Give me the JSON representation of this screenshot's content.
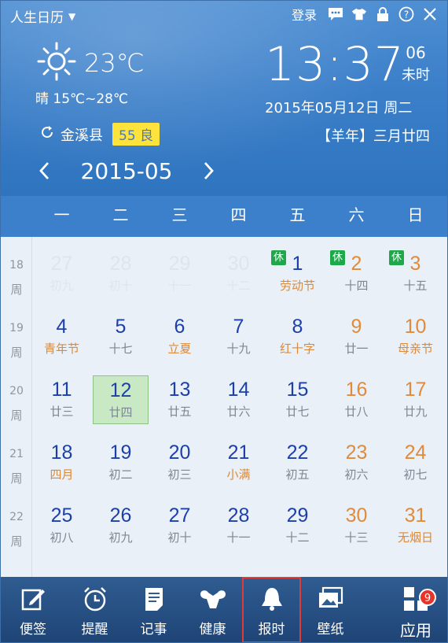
{
  "app": {
    "title": "人生日历"
  },
  "top_actions": {
    "login": "登录"
  },
  "weather": {
    "temp_now": "23℃",
    "desc_range": "晴 15℃~28℃"
  },
  "clock": {
    "time": "13:37",
    "seconds": "06",
    "seconds_label": "未时",
    "date_line": "2015年05月12日 周二"
  },
  "location": {
    "city": "金溪县",
    "aqi": "55 良",
    "lunar": "【羊年】三月廿四"
  },
  "month_nav": {
    "label": "2015-05"
  },
  "weekdays": [
    "一",
    "二",
    "三",
    "四",
    "五",
    "六",
    "日"
  ],
  "weeks": [
    {
      "num": "18",
      "label": "周"
    },
    {
      "num": "19",
      "label": "周"
    },
    {
      "num": "20",
      "label": "周"
    },
    {
      "num": "21",
      "label": "周"
    },
    {
      "num": "22",
      "label": "周"
    }
  ],
  "holiday_tag": "休",
  "days": [
    {
      "day": "27",
      "sub": "初九",
      "style": "muted"
    },
    {
      "day": "28",
      "sub": "初十",
      "style": "muted"
    },
    {
      "day": "29",
      "sub": "十一",
      "style": "muted"
    },
    {
      "day": "30",
      "sub": "十二",
      "style": "muted"
    },
    {
      "day": "1",
      "sub": "劳动节",
      "style": "holiday-weekday",
      "rest": true
    },
    {
      "day": "2",
      "sub": "十四",
      "style": "weekend",
      "rest": true
    },
    {
      "day": "3",
      "sub": "十五",
      "style": "weekend",
      "rest": true
    },
    {
      "day": "4",
      "sub": "青年节",
      "style": "festival"
    },
    {
      "day": "5",
      "sub": "十七",
      "style": "normal"
    },
    {
      "day": "6",
      "sub": "立夏",
      "style": "festival"
    },
    {
      "day": "7",
      "sub": "十九",
      "style": "normal"
    },
    {
      "day": "8",
      "sub": "红十字",
      "style": "festival"
    },
    {
      "day": "9",
      "sub": "廿一",
      "style": "weekend"
    },
    {
      "day": "10",
      "sub": "母亲节",
      "style": "weekend-festival"
    },
    {
      "day": "11",
      "sub": "廿三",
      "style": "normal"
    },
    {
      "day": "12",
      "sub": "廿四",
      "style": "normal",
      "selected": true
    },
    {
      "day": "13",
      "sub": "廿五",
      "style": "normal"
    },
    {
      "day": "14",
      "sub": "廿六",
      "style": "normal"
    },
    {
      "day": "15",
      "sub": "廿七",
      "style": "normal"
    },
    {
      "day": "16",
      "sub": "廿八",
      "style": "weekend"
    },
    {
      "day": "17",
      "sub": "廿九",
      "style": "weekend"
    },
    {
      "day": "18",
      "sub": "四月",
      "style": "festival"
    },
    {
      "day": "19",
      "sub": "初二",
      "style": "normal"
    },
    {
      "day": "20",
      "sub": "初三",
      "style": "normal"
    },
    {
      "day": "21",
      "sub": "小满",
      "style": "festival"
    },
    {
      "day": "22",
      "sub": "初五",
      "style": "normal"
    },
    {
      "day": "23",
      "sub": "初六",
      "style": "weekend"
    },
    {
      "day": "24",
      "sub": "初七",
      "style": "weekend"
    },
    {
      "day": "25",
      "sub": "初八",
      "style": "normal"
    },
    {
      "day": "26",
      "sub": "初九",
      "style": "normal"
    },
    {
      "day": "27",
      "sub": "初十",
      "style": "normal"
    },
    {
      "day": "28",
      "sub": "十一",
      "style": "normal"
    },
    {
      "day": "29",
      "sub": "十二",
      "style": "normal"
    },
    {
      "day": "30",
      "sub": "十三",
      "style": "weekend"
    },
    {
      "day": "31",
      "sub": "无烟日",
      "style": "weekend-festival"
    }
  ],
  "toolbar": [
    {
      "label": "便签",
      "icon": "note-icon"
    },
    {
      "label": "提醒",
      "icon": "alarm-icon"
    },
    {
      "label": "记事",
      "icon": "journal-icon"
    },
    {
      "label": "健康",
      "icon": "health-icon"
    },
    {
      "label": "报时",
      "icon": "bell-icon"
    },
    {
      "label": "壁纸",
      "icon": "wallpaper-icon"
    },
    {
      "label": "应用",
      "icon": "apps-icon",
      "badge": "9"
    }
  ],
  "colors": {
    "header": "#3b7fc9",
    "weekbar": "#3c7fca",
    "toolbar": "#2f5c91",
    "blue_day": "#1d3fa8",
    "orange_day": "#e08a3b",
    "selected": "#c9e9c5",
    "aqi": "#ffe33d",
    "rest_tag": "#1fa84a"
  }
}
